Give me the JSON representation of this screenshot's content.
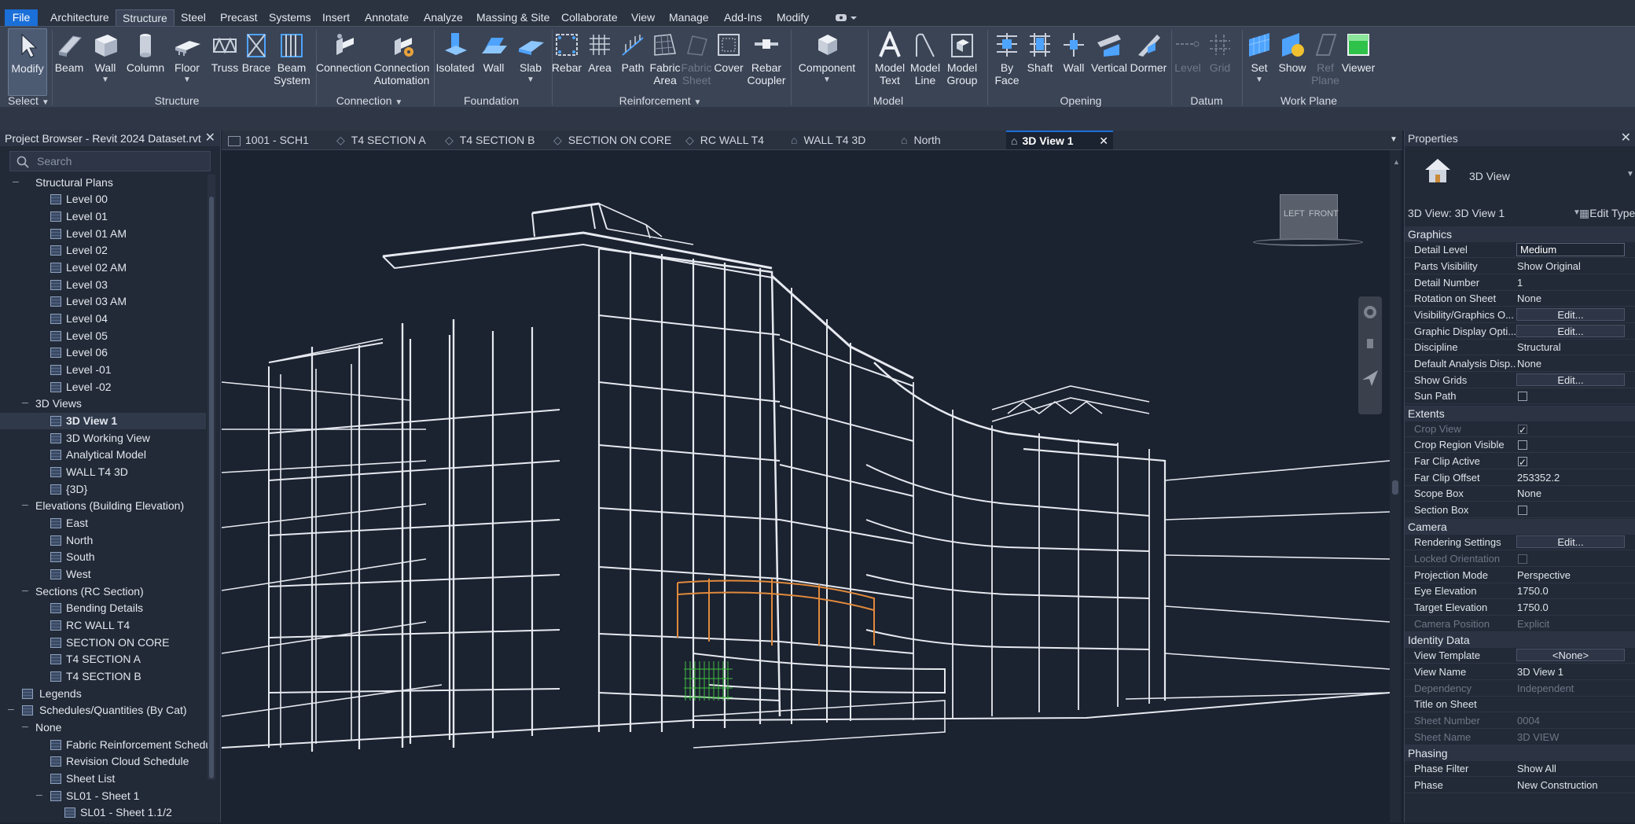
{
  "menubar": {
    "tabs": [
      "File",
      "Architecture",
      "Structure",
      "Steel",
      "Precast",
      "Systems",
      "Insert",
      "Annotate",
      "Analyze",
      "Massing & Site",
      "Collaborate",
      "View",
      "Manage",
      "Add-Ins",
      "Modify"
    ],
    "active": "Structure"
  },
  "ribbon": {
    "buttons": [
      {
        "label": "Modify",
        "icon": "cursor-icon"
      },
      {
        "label": "Beam",
        "icon": "beam-icon"
      },
      {
        "label": "Wall",
        "icon": "wall-icon"
      },
      {
        "label": "Column",
        "icon": "column-icon"
      },
      {
        "label": "Floor",
        "icon": "floor-icon"
      },
      {
        "label": "Truss",
        "icon": "truss-icon"
      },
      {
        "label": "Brace",
        "icon": "brace-icon"
      },
      {
        "label": "Beam System",
        "icon": "beam-system-icon"
      },
      {
        "label": "Connection",
        "icon": "connection-icon"
      },
      {
        "label": "Connection Automation",
        "icon": "connection-automation-icon"
      },
      {
        "label": "Isolated",
        "icon": "isolated-foundation-icon"
      },
      {
        "label": "Wall",
        "icon": "wall-foundation-icon"
      },
      {
        "label": "Slab",
        "icon": "slab-icon"
      },
      {
        "label": "Rebar",
        "icon": "rebar-icon"
      },
      {
        "label": "Area",
        "icon": "area-rebar-icon"
      },
      {
        "label": "Path",
        "icon": "path-rebar-icon"
      },
      {
        "label": "Fabric Area",
        "icon": "fabric-area-icon"
      },
      {
        "label": "Fabric Sheet",
        "icon": "fabric-sheet-icon"
      },
      {
        "label": "Cover",
        "icon": "cover-icon"
      },
      {
        "label": "Rebar Coupler",
        "icon": "rebar-coupler-icon"
      },
      {
        "label": "Component",
        "icon": "component-icon"
      },
      {
        "label": "Model Text",
        "icon": "model-text-icon"
      },
      {
        "label": "Model Line",
        "icon": "model-line-icon"
      },
      {
        "label": "Model Group",
        "icon": "model-group-icon"
      },
      {
        "label": "By Face",
        "icon": "by-face-icon"
      },
      {
        "label": "Shaft",
        "icon": "shaft-icon"
      },
      {
        "label": "Wall",
        "icon": "wall-opening-icon"
      },
      {
        "label": "Vertical",
        "icon": "vertical-opening-icon"
      },
      {
        "label": "Dormer",
        "icon": "dormer-icon"
      },
      {
        "label": "Level",
        "icon": "level-icon"
      },
      {
        "label": "Grid",
        "icon": "grid-icon"
      },
      {
        "label": "Set",
        "icon": "set-workplane-icon"
      },
      {
        "label": "Show",
        "icon": "show-workplane-icon"
      },
      {
        "label": "Ref Plane",
        "icon": "ref-plane-icon"
      },
      {
        "label": "Viewer",
        "icon": "viewer-icon"
      }
    ],
    "panels": [
      "Select",
      "Structure",
      "Connection",
      "Foundation",
      "Reinforcement",
      "Model",
      "Opening",
      "Datum",
      "Work Plane"
    ]
  },
  "browser": {
    "title": "Project Browser - Revit 2024 Dataset.rvt",
    "search_placeholder": "Search",
    "items": [
      {
        "label": "Structural Plans"
      },
      {
        "label": "Level 00"
      },
      {
        "label": "Level 01"
      },
      {
        "label": "Level 01 AM"
      },
      {
        "label": "Level 02"
      },
      {
        "label": "Level 02 AM"
      },
      {
        "label": "Level 03"
      },
      {
        "label": "Level 03 AM"
      },
      {
        "label": "Level 04"
      },
      {
        "label": "Level 05"
      },
      {
        "label": "Level 06"
      },
      {
        "label": "Level -01"
      },
      {
        "label": "Level -02"
      },
      {
        "label": "3D Views"
      },
      {
        "label": "3D View 1"
      },
      {
        "label": "3D Working View"
      },
      {
        "label": "Analytical Model"
      },
      {
        "label": "WALL T4 3D"
      },
      {
        "label": "{3D}"
      },
      {
        "label": "Elevations (Building Elevation)"
      },
      {
        "label": "East"
      },
      {
        "label": "North"
      },
      {
        "label": "South"
      },
      {
        "label": "West"
      },
      {
        "label": "Sections (RC Section)"
      },
      {
        "label": "Bending Details"
      },
      {
        "label": "RC WALL T4"
      },
      {
        "label": "SECTION ON CORE"
      },
      {
        "label": "T4 SECTION A"
      },
      {
        "label": "T4 SECTION B"
      },
      {
        "label": "Legends"
      },
      {
        "label": "Schedules/Quantities (By Cat)"
      },
      {
        "label": "None"
      },
      {
        "label": "Fabric Reinforcement Schedule"
      },
      {
        "label": "Revision Cloud Schedule"
      },
      {
        "label": "Sheet List"
      },
      {
        "label": "SL01 - Sheet 1"
      },
      {
        "label": "SL01 - Sheet 1.1/2"
      }
    ]
  },
  "view_tabs": [
    {
      "label": "1001 - SCH1",
      "icon": "sheet-icon"
    },
    {
      "label": "T4 SECTION A",
      "icon": "section-icon"
    },
    {
      "label": "T4 SECTION B",
      "icon": "section-icon"
    },
    {
      "label": "SECTION ON CORE",
      "icon": "section-icon"
    },
    {
      "label": "RC WALL T4",
      "icon": "section-icon"
    },
    {
      "label": "WALL T4 3D",
      "icon": "3d-view-icon"
    },
    {
      "label": "North",
      "icon": "elevation-icon"
    },
    {
      "label": "3D View 1",
      "icon": "3d-view-icon"
    }
  ],
  "viewcube": {
    "faces": [
      "LEFT",
      "FRONT"
    ]
  },
  "properties": {
    "title": "Properties",
    "type_name": "3D View",
    "type_selector": "3D View: 3D View 1",
    "edit_type": "Edit Type",
    "sections": [
      {
        "name": "Graphics",
        "rows": [
          {
            "key": "Detail Level",
            "value": "Medium",
            "kind": "field"
          },
          {
            "key": "Parts Visibility",
            "value": "Show Original"
          },
          {
            "key": "Detail Number",
            "value": "1"
          },
          {
            "key": "Rotation on Sheet",
            "value": "None"
          },
          {
            "key": "Visibility/Graphics O...",
            "value": "Edit...",
            "kind": "button"
          },
          {
            "key": "Graphic Display Opti...",
            "value": "Edit...",
            "kind": "button"
          },
          {
            "key": "Discipline",
            "value": "Structural"
          },
          {
            "key": "Default Analysis Disp...",
            "value": "None"
          },
          {
            "key": "Show Grids",
            "value": "Edit...",
            "kind": "button"
          },
          {
            "key": "Sun Path",
            "value": "",
            "kind": "check",
            "checked": false
          }
        ]
      },
      {
        "name": "Extents",
        "rows": [
          {
            "key": "Crop View",
            "value": "",
            "kind": "check",
            "checked": true,
            "dim": true
          },
          {
            "key": "Crop Region Visible",
            "value": "",
            "kind": "check",
            "checked": false
          },
          {
            "key": "Far Clip Active",
            "value": "",
            "kind": "check",
            "checked": true
          },
          {
            "key": "Far Clip Offset",
            "value": "253352.2"
          },
          {
            "key": "Scope Box",
            "value": "None"
          },
          {
            "key": "Section Box",
            "value": "",
            "kind": "check",
            "checked": false
          }
        ]
      },
      {
        "name": "Camera",
        "rows": [
          {
            "key": "Rendering Settings",
            "value": "Edit...",
            "kind": "button"
          },
          {
            "key": "Locked Orientation",
            "value": "",
            "kind": "check",
            "checked": false,
            "dim": true
          },
          {
            "key": "Projection Mode",
            "value": "Perspective"
          },
          {
            "key": "Eye Elevation",
            "value": "1750.0"
          },
          {
            "key": "Target Elevation",
            "value": "1750.0"
          },
          {
            "key": "Camera Position",
            "value": "Explicit",
            "dim": true
          }
        ]
      },
      {
        "name": "Identity Data",
        "rows": [
          {
            "key": "View Template",
            "value": "<None>",
            "kind": "button"
          },
          {
            "key": "View Name",
            "value": "3D View 1"
          },
          {
            "key": "Dependency",
            "value": "Independent",
            "dim": true
          },
          {
            "key": "Title on Sheet",
            "value": ""
          },
          {
            "key": "Sheet Number",
            "value": "0004",
            "dim": true
          },
          {
            "key": "Sheet Name",
            "value": "3D VIEW",
            "dim": true
          }
        ]
      },
      {
        "name": "Phasing",
        "rows": [
          {
            "key": "Phase Filter",
            "value": "Show All"
          },
          {
            "key": "Phase",
            "value": "New Construction"
          }
        ]
      }
    ]
  },
  "colors": {
    "accent": "#1b6fd8",
    "highlight": "#e08a3c",
    "rebar": "#3fbf3f"
  }
}
